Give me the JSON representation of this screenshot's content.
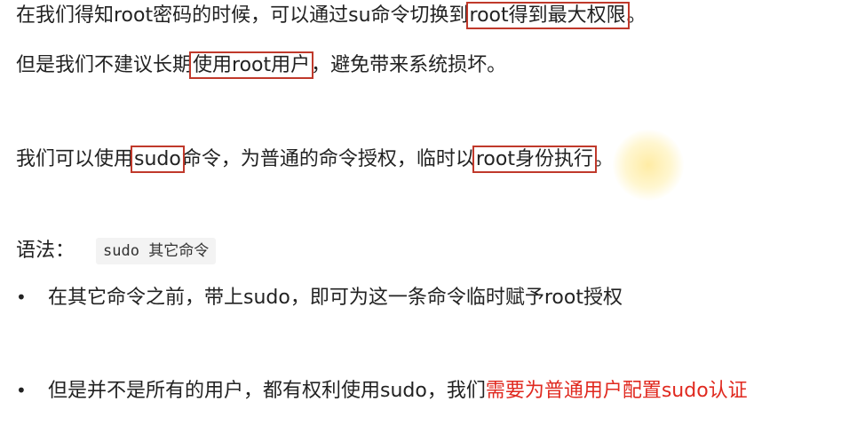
{
  "para1": {
    "line1_a": "在我们得知root密码的时候，可以通过su命令切换到",
    "line1_boxed": "root得到最大权限",
    "line1_end": "。",
    "line2_a": "但是我们不建议长期",
    "line2_boxed": "使用root用户",
    "line2_end": "，避免带来系统损坏。"
  },
  "para2": {
    "a": "我们可以使用",
    "boxed1": "sudo",
    "b": "命令，为普通的命令授权，临时以",
    "boxed2": "root身份执行",
    "end": "。"
  },
  "syntax": {
    "label": "语法：",
    "code": "sudo 其它命令"
  },
  "bullets": {
    "marker": "•",
    "item1": "在其它命令之前，带上sudo，即可为这一条命令临时赋予root授权",
    "item2_a": "但是并不是所有的用户，都有权利使用sudo，我们",
    "item2_red": "需要为普通用户配置sudo认证"
  },
  "colors": {
    "box_border": "#c0392b",
    "emphasis_red": "#e0291f",
    "cursor_highlight": "#ffdc5a"
  }
}
